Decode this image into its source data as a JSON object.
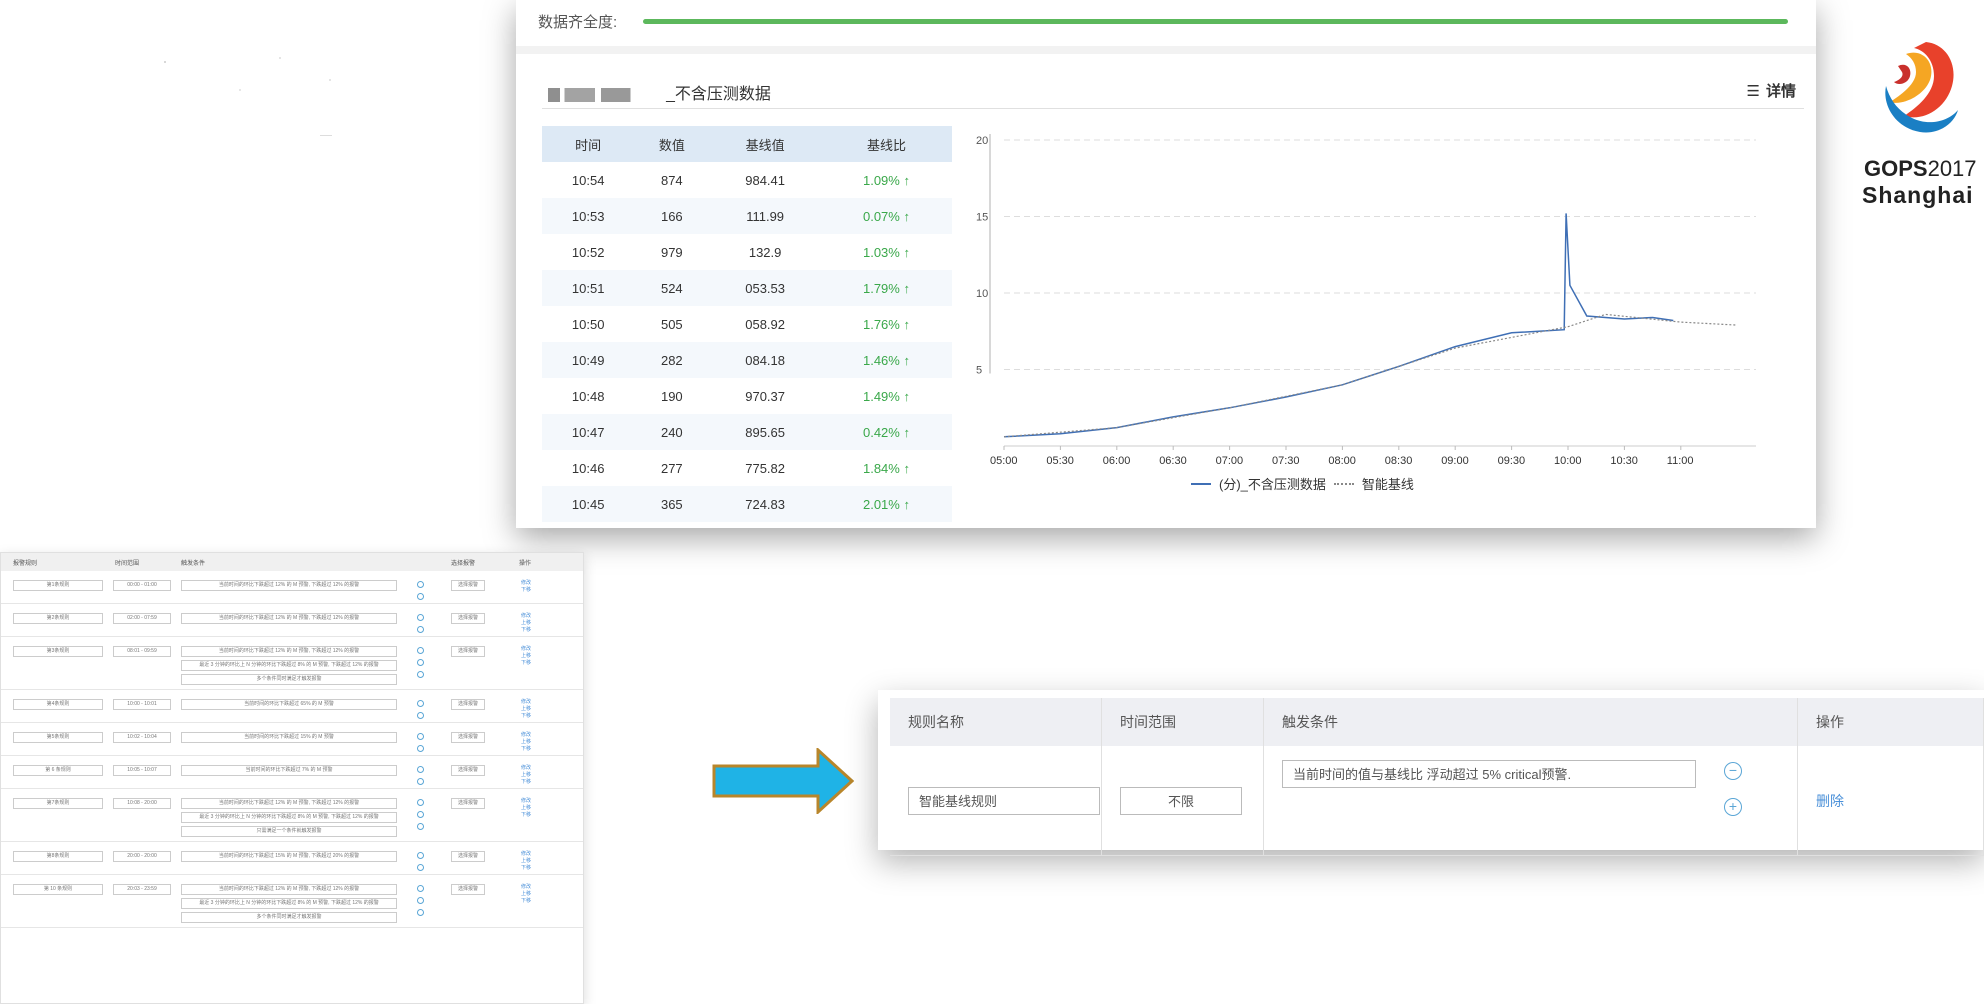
{
  "top_panel": {
    "completeness_label": "数据齐全度:",
    "chart_title": "_不含压测数据",
    "detail_label": "详情",
    "table_headers": [
      "时间",
      "数值",
      "基线值",
      "基线比"
    ],
    "table_rows": [
      {
        "time": "10:54",
        "value": "874",
        "baseline": "984.41",
        "ratio": "1.09% ↑"
      },
      {
        "time": "10:53",
        "value": "166",
        "baseline": "111.99",
        "ratio": "0.07% ↑"
      },
      {
        "time": "10:52",
        "value": "979",
        "baseline": "132.9",
        "ratio": "1.03% ↑"
      },
      {
        "time": "10:51",
        "value": "524",
        "baseline": "053.53",
        "ratio": "1.79% ↑"
      },
      {
        "time": "10:50",
        "value": "505",
        "baseline": "058.92",
        "ratio": "1.76% ↑"
      },
      {
        "time": "10:49",
        "value": "282",
        "baseline": "084.18",
        "ratio": "1.46% ↑"
      },
      {
        "time": "10:48",
        "value": "190",
        "baseline": "970.37",
        "ratio": "1.49% ↑"
      },
      {
        "time": "10:47",
        "value": "240",
        "baseline": "895.65",
        "ratio": "0.42% ↑"
      },
      {
        "time": "10:46",
        "value": "277",
        "baseline": "775.82",
        "ratio": "1.84% ↑"
      },
      {
        "time": "10:45",
        "value": "365",
        "baseline": "724.83",
        "ratio": "2.01% ↑"
      }
    ],
    "colors": {
      "completeness_bar": "#5cb85c",
      "ratio_up": "#3aa84a",
      "header_bg": "#dde9f5"
    }
  },
  "chart_data": {
    "type": "line",
    "x_ticks": [
      "05:00",
      "05:30",
      "06:00",
      "06:30",
      "07:00",
      "07:30",
      "08:00",
      "08:30",
      "09:00",
      "09:30",
      "10:00",
      "10:30",
      "11:00"
    ],
    "y_ticks": [
      "5",
      "10",
      "15",
      "20"
    ],
    "ylim": [
      0,
      20
    ],
    "series": [
      {
        "name": "(分)_不含压测数据",
        "style": "solid",
        "color": "#3f6fb5",
        "points": [
          [
            0,
            0.6
          ],
          [
            30,
            0.8
          ],
          [
            60,
            1.2
          ],
          [
            90,
            1.9
          ],
          [
            120,
            2.5
          ],
          [
            150,
            3.2
          ],
          [
            180,
            4.0
          ],
          [
            210,
            5.2
          ],
          [
            240,
            6.5
          ],
          [
            270,
            7.4
          ],
          [
            298,
            7.6
          ],
          [
            299,
            15.2
          ],
          [
            301,
            10.5
          ],
          [
            310,
            8.5
          ],
          [
            330,
            8.3
          ],
          [
            345,
            8.4
          ],
          [
            356,
            8.2
          ]
        ]
      },
      {
        "name": "智能基线",
        "style": "dotted",
        "color": "#888888",
        "points": [
          [
            0,
            0.6
          ],
          [
            60,
            1.2
          ],
          [
            120,
            2.5
          ],
          [
            180,
            4.0
          ],
          [
            240,
            6.4
          ],
          [
            300,
            7.8
          ],
          [
            320,
            8.6
          ],
          [
            360,
            8.1
          ],
          [
            390,
            7.9
          ]
        ]
      }
    ],
    "legend": [
      "(分)_不含压测数据",
      "智能基线"
    ],
    "legend_position": "bottom",
    "grid": true
  },
  "logo": {
    "line1_bold": "GOPS",
    "line1_year": "2017",
    "line2": "Shanghai"
  },
  "left_panel": {
    "headers": [
      "报警规则",
      "时间范围",
      "触发条件",
      "选择报警",
      "操作"
    ],
    "rows": [
      {
        "name": "第1条规则",
        "time": "00:00 - 01:00",
        "conds": [
          "当前时间的环比下跌超过 12% 的 M 预警, 下跌超过 12% 的报警"
        ],
        "alarm": "选择报警",
        "ops": [
          "修改",
          "下移"
        ]
      },
      {
        "name": "第2条规则",
        "time": "02:00 - 07:59",
        "conds": [
          "当前时间的环比下跌超过 12% 的 M 预警, 下跌超过 12% 的报警"
        ],
        "alarm": "选择报警",
        "ops": [
          "修改",
          "上移",
          "下移"
        ]
      },
      {
        "name": "第3条规则",
        "time": "08:01 - 09:59",
        "conds": [
          "当前时间的环比下跌超过 12% 的 M 预警, 下跌超过 12% 的报警",
          "最近 3 分钟的环比上 N 分钟的环比下跌超过 8% 的 M 预警, 下跌超过 12% 的报警",
          "多个条件同时满足才触发报警"
        ],
        "alarm": "选择报警",
        "ops": [
          "修改",
          "上移",
          "下移"
        ]
      },
      {
        "name": "第4条规则",
        "time": "10:00 - 10:01",
        "conds": [
          "当前时间的环比下跌超过 65% 的 M 预警"
        ],
        "alarm": "选择报警",
        "ops": [
          "修改",
          "上移",
          "下移"
        ]
      },
      {
        "name": "第5条规则",
        "time": "10:02 - 10:04",
        "conds": [
          "当前时间的环比下跌超过 15% 的 M 预警"
        ],
        "alarm": "选择报警",
        "ops": [
          "修改",
          "上移",
          "下移"
        ]
      },
      {
        "name": "第 6 条规则",
        "time": "10:05 - 10:07",
        "conds": [
          "当前时间的环比下跌超过 7% 的 M 预警"
        ],
        "alarm": "选择报警",
        "ops": [
          "修改",
          "上移",
          "下移"
        ]
      },
      {
        "name": "第7条规则",
        "time": "10:08 - 20:00",
        "conds": [
          "当前时间的环比下跌超过 12% 的 M 预警, 下跌超过 12% 的报警",
          "最近 3 分钟的环比上 N 分钟的环比下跌超过 8% 的 M 预警, 下跌超过 12% 的报警",
          "只需满足一个条件就触发报警"
        ],
        "alarm": "选择报警",
        "ops": [
          "修改",
          "上移",
          "下移"
        ]
      },
      {
        "name": "第8条规则",
        "time": "20:00 - 20:00",
        "conds": [
          "当前时间的环比下跌超过 15% 的 M 预警, 下跌超过 20% 的报警"
        ],
        "alarm": "选择报警",
        "ops": [
          "修改",
          "上移",
          "下移"
        ]
      },
      {
        "name": "第 10 条规则",
        "time": "20:03 - 23:59",
        "conds": [
          "当前时间的环比下跌超过 12% 的 M 预警, 下跌超过 12% 的报警",
          "最近 3 分钟的环比上 N 分钟的环比下跌超过 8% 的 M 预警, 下跌超过 12% 的报警",
          "多个条件同时满足才触发报警"
        ],
        "alarm": "选择报警",
        "ops": [
          "修改",
          "上移",
          "下移"
        ]
      }
    ]
  },
  "arrow": {
    "fill": "#1fb3e6",
    "border": "#b8862b"
  },
  "rule_panel": {
    "headers": [
      "规则名称",
      "时间范围",
      "触发条件",
      "操作"
    ],
    "rule_name": "智能基线规则",
    "time_range": "不限",
    "condition": "当前时间的值与基线比 浮动超过 5% critical预警.",
    "delete_label": "删除",
    "minus_symbol": "−",
    "plus_symbol": "+"
  }
}
